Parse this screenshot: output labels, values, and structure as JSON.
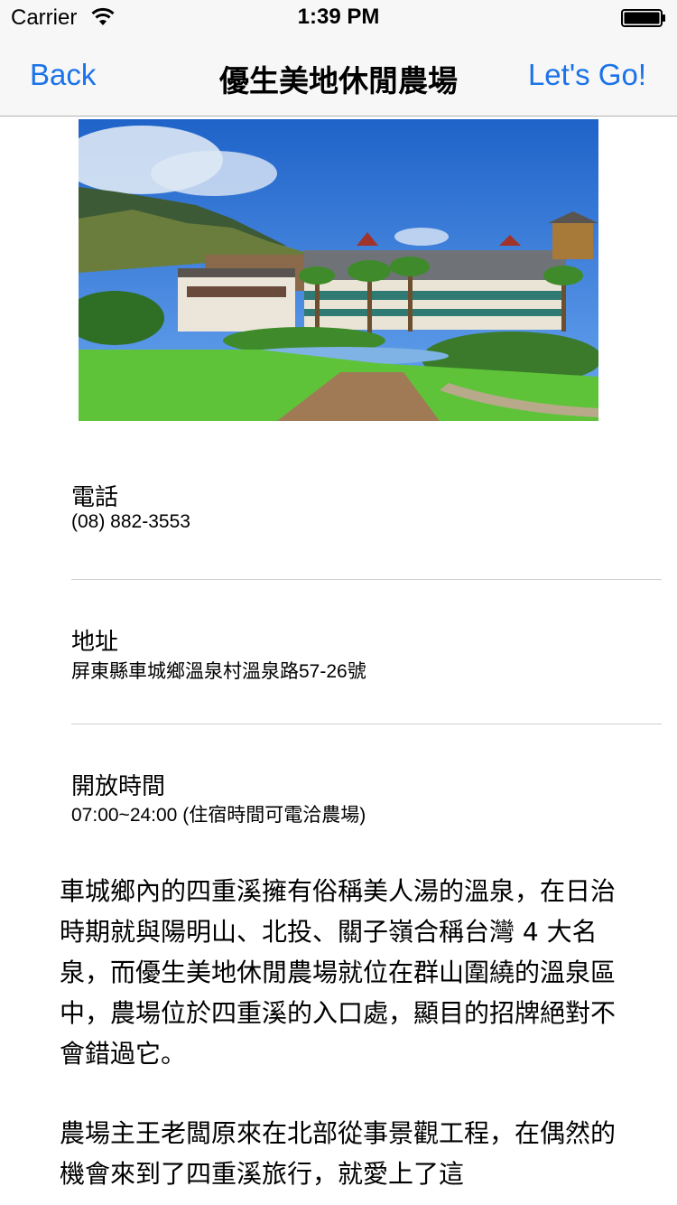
{
  "status_bar": {
    "carrier": "Carrier",
    "time": "1:39 PM"
  },
  "nav": {
    "back_label": "Back",
    "title": "優生美地休閒農場",
    "action_label": "Let's Go!",
    "accent_color": "#1a73e8"
  },
  "photo": {
    "icon": "farm-photo"
  },
  "info": {
    "phone_label": "電話",
    "phone_value": "(08) 882-3553",
    "address_label": "地址",
    "address_value": "屏東縣車城鄉溫泉村溫泉路57-26號",
    "hours_label": "開放時間",
    "hours_value": "07:00~24:00 (住宿時間可電洽農場)"
  },
  "article": {
    "paragraph_1": "車城鄉內的四重溪擁有俗稱美人湯的溫泉，在日治時期就與陽明山、北投、關子嶺合稱台灣 4 大名泉，而優生美地休閒農場就位在群山圍繞的溫泉區中，農場位於四重溪的入口處，顯目的招牌絕對不會錯過它。",
    "paragraph_2": "農場主王老闆原來在北部從事景觀工程，在偶然的機會來到了四重溪旅行，就愛上了這"
  }
}
